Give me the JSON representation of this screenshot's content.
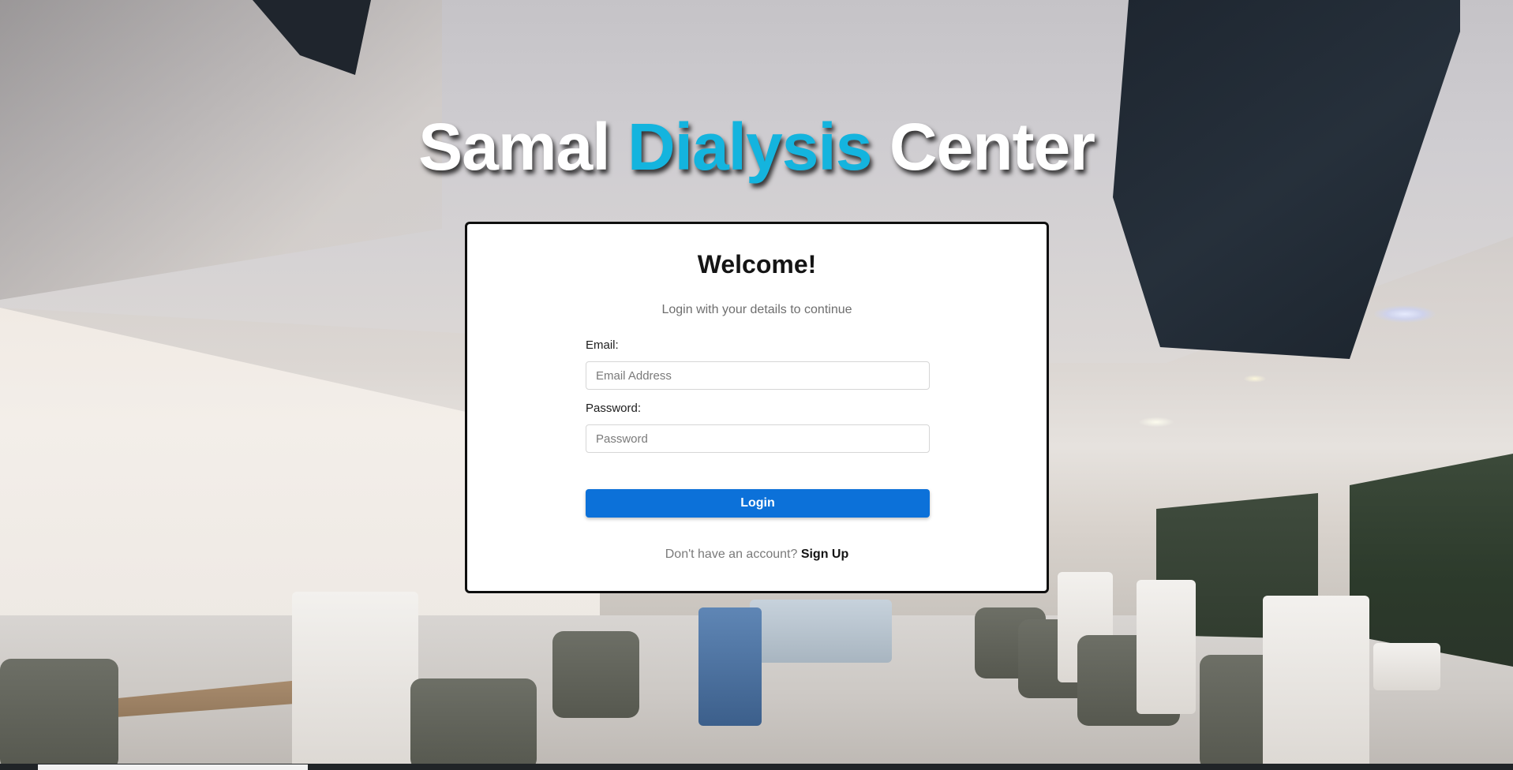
{
  "header": {
    "title_part1": "Samal ",
    "title_accent": "Dialysis",
    "title_part2": " Center"
  },
  "login_card": {
    "heading": "Welcome!",
    "subtitle": "Login with your details to continue",
    "email_label": "Email:",
    "email_placeholder": "Email Address",
    "email_value": "",
    "password_label": "Password:",
    "password_placeholder": "Password",
    "password_value": "",
    "login_button_label": "Login",
    "signup_prompt": "Don't have an account?",
    "signup_link_label": "Sign Up"
  },
  "colors": {
    "accent": "#14b4de",
    "button": "#0c71d9",
    "card_border": "#0e0e0e"
  }
}
